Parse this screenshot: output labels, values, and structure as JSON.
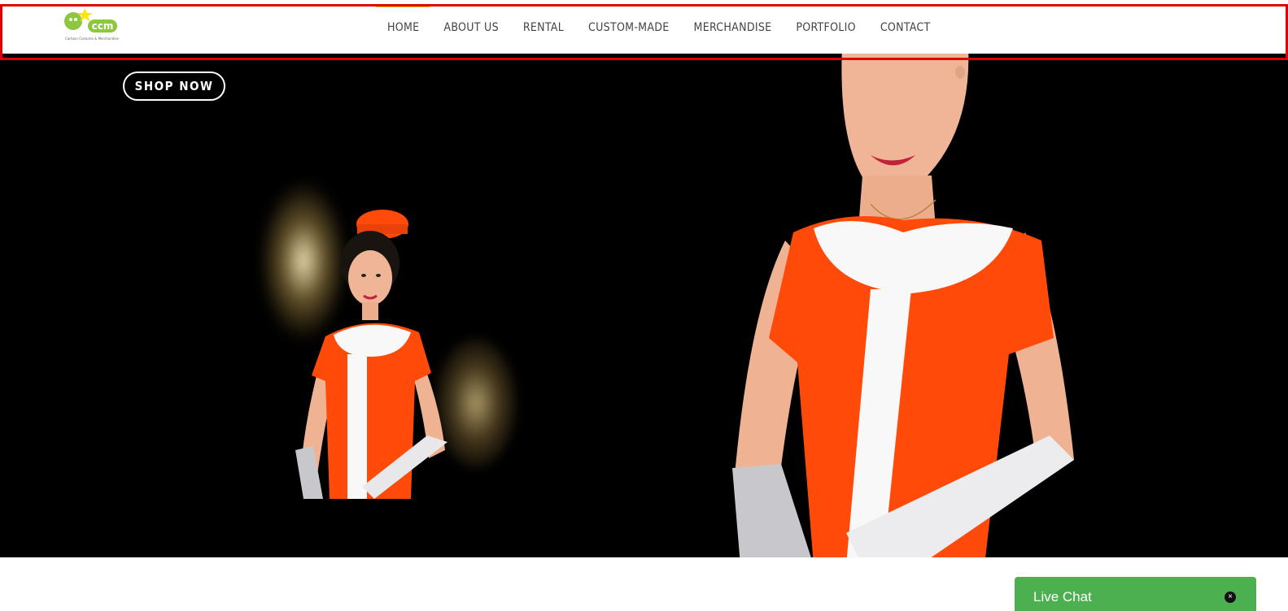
{
  "header": {
    "logo_text": "ccm",
    "logo_tagline": "Cartoon Costume & Merchandise",
    "nav": [
      {
        "label": "HOME"
      },
      {
        "label": "ABOUT US"
      },
      {
        "label": "RENTAL"
      },
      {
        "label": "CUSTOM-MADE"
      },
      {
        "label": "MERCHANDISE"
      },
      {
        "label": "PORTFOLIO"
      },
      {
        "label": "CONTACT"
      }
    ]
  },
  "hero": {
    "shop_label": "SHOP NOW"
  },
  "chat": {
    "label": "Live Chat",
    "close_symbol": "×"
  },
  "colors": {
    "highlight_border": "#e10000",
    "nav_active_accent": "#f5c400",
    "chat_bg": "#4caf50",
    "uniform_orange": "#ff4a0a"
  }
}
